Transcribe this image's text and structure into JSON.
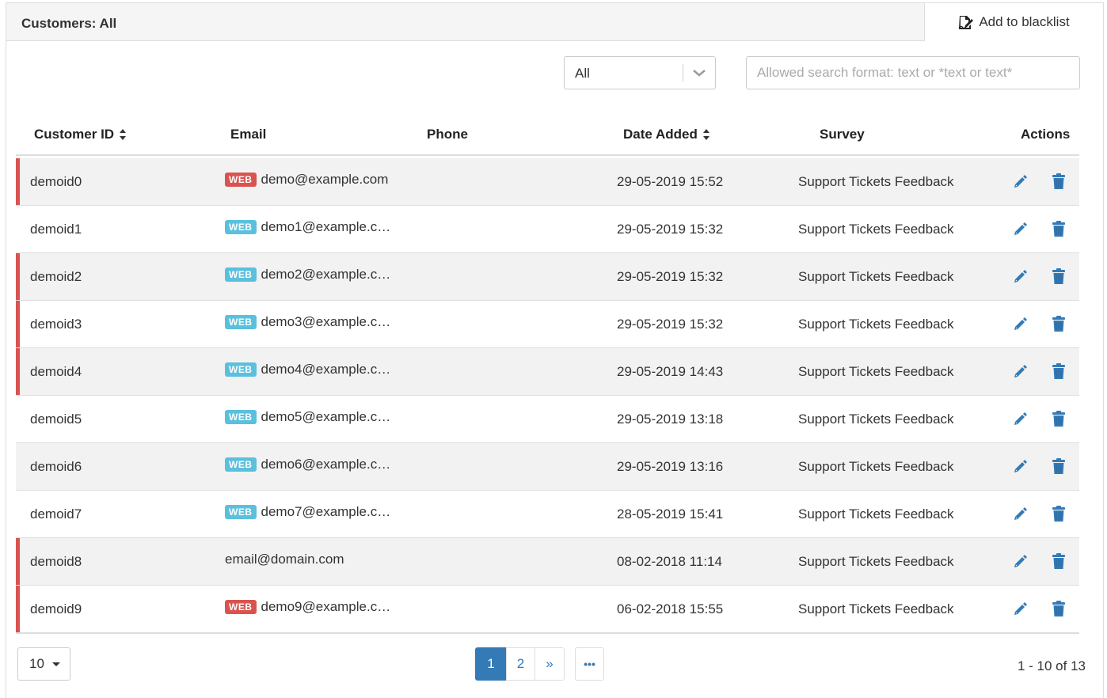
{
  "header": {
    "title": "Customers: All",
    "blacklist_label": "Add to blacklist"
  },
  "filter": {
    "selected": "All"
  },
  "search": {
    "value": "",
    "placeholder": "Allowed search format: text or *text or text*"
  },
  "columns": {
    "customer_id": "Customer ID",
    "email": "Email",
    "phone": "Phone",
    "date_added": "Date Added",
    "survey": "Survey",
    "actions": "Actions"
  },
  "rows": [
    {
      "id": "demoid0",
      "badge": "WEB",
      "email": "demo@example.com",
      "phone": "",
      "date": "29-05-2019 15:52",
      "survey": "Support Tickets Feedback"
    },
    {
      "id": "demoid1",
      "badge": "WEB",
      "email": "demo1@example.c…",
      "phone": "",
      "date": "29-05-2019 15:32",
      "survey": "Support Tickets Feedback"
    },
    {
      "id": "demoid2",
      "badge": "WEB",
      "email": "demo2@example.c…",
      "phone": "",
      "date": "29-05-2019 15:32",
      "survey": "Support Tickets Feedback"
    },
    {
      "id": "demoid3",
      "badge": "WEB",
      "email": "demo3@example.c…",
      "phone": "",
      "date": "29-05-2019 15:32",
      "survey": "Support Tickets Feedback"
    },
    {
      "id": "demoid4",
      "badge": "WEB",
      "email": "demo4@example.c…",
      "phone": "",
      "date": "29-05-2019 14:43",
      "survey": "Support Tickets Feedback"
    },
    {
      "id": "demoid5",
      "badge": "WEB",
      "email": "demo5@example.c…",
      "phone": "",
      "date": "29-05-2019 13:18",
      "survey": "Support Tickets Feedback"
    },
    {
      "id": "demoid6",
      "badge": "WEB",
      "email": "demo6@example.c…",
      "phone": "",
      "date": "29-05-2019 13:16",
      "survey": "Support Tickets Feedback"
    },
    {
      "id": "demoid7",
      "badge": "WEB",
      "email": "demo7@example.c…",
      "phone": "",
      "date": "28-05-2019 15:41",
      "survey": "Support Tickets Feedback"
    },
    {
      "id": "demoid8",
      "badge": "",
      "email": "email@domain.com",
      "phone": "",
      "date": "08-02-2018 11:14",
      "survey": "Support Tickets Feedback"
    },
    {
      "id": "demoid9",
      "badge": "WEB",
      "email": "demo9@example.c…",
      "phone": "",
      "date": "06-02-2018 15:55",
      "survey": "Support Tickets Feedback"
    }
  ],
  "pagination": {
    "per_page": "10",
    "pages": [
      "1",
      "2"
    ],
    "next": "»",
    "more": "•••",
    "range": "1 - 10 of 13"
  },
  "colors": {
    "flag_red": "#d9534f",
    "badge_web": "#5bc0de",
    "action_blue": "#337ab7"
  }
}
